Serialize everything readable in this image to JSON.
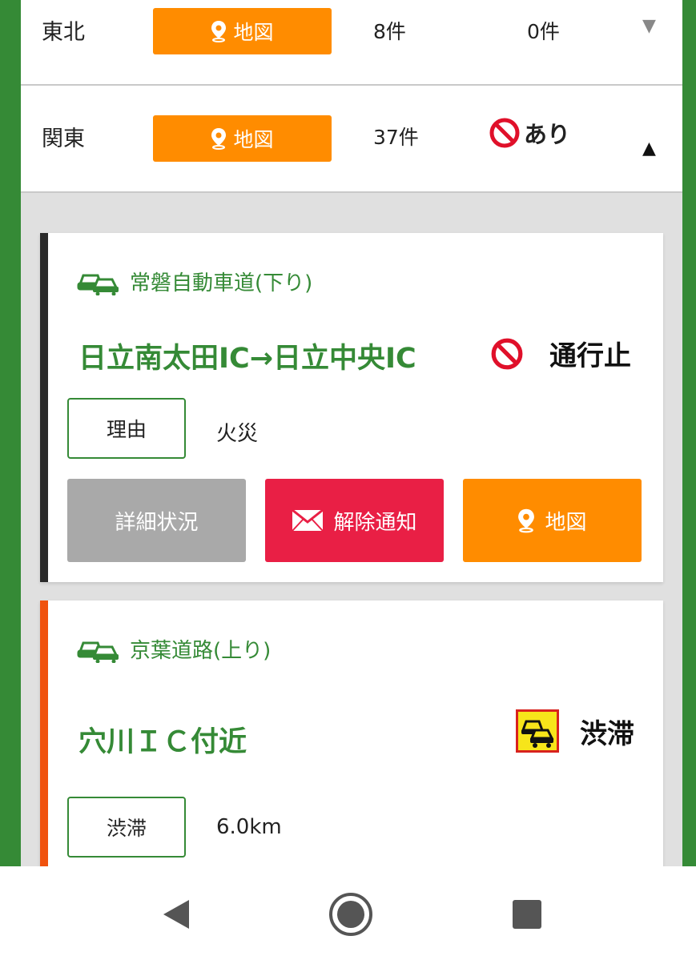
{
  "regions": [
    {
      "name": "東北",
      "map_label": "地図",
      "count": "8件",
      "status": "0件",
      "expanded": false
    },
    {
      "name": "関東",
      "map_label": "地図",
      "count": "37件",
      "status": "あり",
      "expanded": true
    }
  ],
  "cards": [
    {
      "road": "常磐自動車道(下り)",
      "section": "日立南太田IC→日立中央IC",
      "event": "通行止",
      "tag_label": "理由",
      "tag_value": "火災",
      "buttons": {
        "detail": "詳細状況",
        "notify": "解除通知",
        "map": "地図"
      }
    },
    {
      "road": "京葉道路(上り)",
      "section": "穴川ＩＣ付近",
      "event": "渋滞",
      "tag_label": "渋滞",
      "tag_value": "6.0km"
    }
  ],
  "colors": {
    "brand_green": "#358a36",
    "map_orange": "#ff8c00",
    "notify_red": "#e91f45",
    "detail_gray": "#a9a9a9",
    "closure_stripe": "#2a2a2a",
    "jam_stripe": "#f0520e"
  },
  "icons": {
    "map": "map-pin-icon",
    "closure": "no-entry-icon",
    "road": "cars-icon",
    "jam": "traffic-jam-icon",
    "mail": "envelope-icon"
  }
}
